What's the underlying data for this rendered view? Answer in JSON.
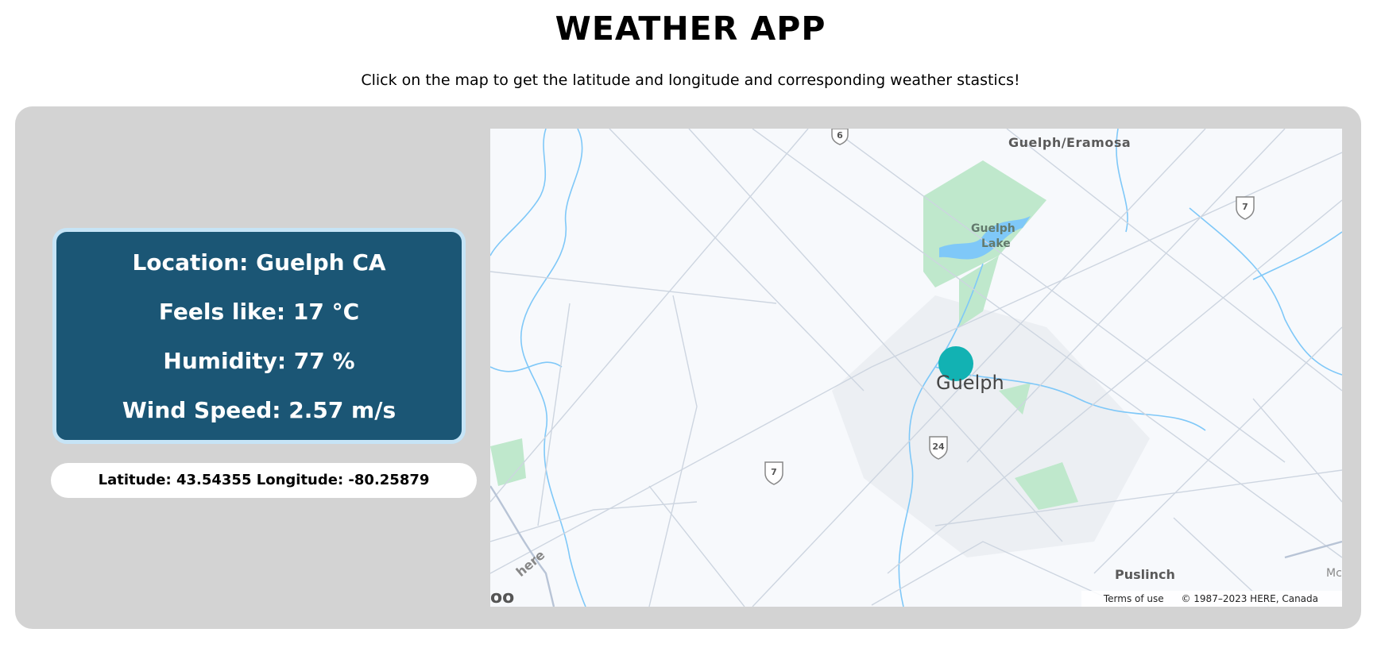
{
  "header": {
    "title": "WEATHER APP",
    "subtitle": "Click on the map to get the latitude and longitude and corresponding weather stastics!"
  },
  "weather": {
    "location": "Location: Guelph CA",
    "feels_like": "Feels like: 17 °C",
    "humidity": "Humidity: 77 %",
    "wind_speed": "Wind Speed: 2.57 m/s"
  },
  "coordinates": {
    "text": "Latitude: 43.54355 Longitude: -80.25879"
  },
  "map": {
    "labels": {
      "guelph_eramosa": "Guelph/Eramosa",
      "guelph_lake": "Guelph",
      "guelph_lake_2": "Lake",
      "guelph": "Guelph",
      "puslinch": "Puslinch",
      "here_logo": "here",
      "corner_left": "oo",
      "corner_right": "Mc"
    },
    "route_shields": [
      "6",
      "7",
      "7",
      "24"
    ],
    "attribution": {
      "terms": "Terms of use",
      "copyright": "© 1987–2023 HERE, Canada"
    },
    "marker_color": "#12b2b3",
    "water_color": "#7fc8f8",
    "park_color": "#bfe8cc"
  },
  "colors": {
    "panel": "#d3d3d3",
    "card": "#1b5675",
    "card_border": "#c6e4f6"
  }
}
